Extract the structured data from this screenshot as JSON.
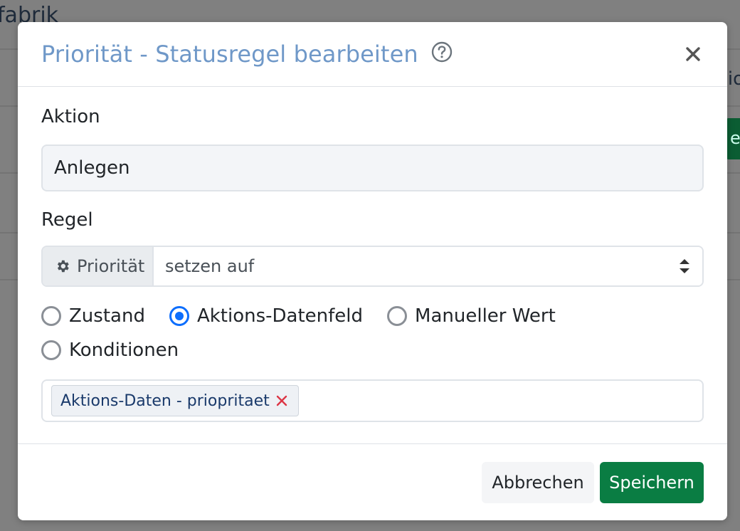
{
  "background": {
    "title_fragment": "fabrik",
    "right_text_fragment": "io",
    "right_button_fragment": "er"
  },
  "modal": {
    "title": "Priorität - Statusregel bearbeiten",
    "action_section": {
      "label": "Aktion",
      "value": "Anlegen"
    },
    "rule_section": {
      "label": "Regel",
      "addon_label": "Priorität",
      "select_value": "setzen auf"
    },
    "radio_options": [
      {
        "label": "Zustand",
        "checked": false
      },
      {
        "label": "Aktions-Datenfeld",
        "checked": true
      },
      {
        "label": "Manueller Wert",
        "checked": false
      },
      {
        "label": "Konditionen",
        "checked": false
      }
    ],
    "tag": {
      "label": "Aktions-Daten - priopritaet"
    },
    "footer": {
      "cancel_label": "Abbrechen",
      "save_label": "Speichern"
    }
  },
  "colors": {
    "title": "#6f98c8",
    "primary": "#0d6efd",
    "save_button": "#0a7d43",
    "tag_remove": "#dc3545"
  },
  "icons": {
    "help": "question-circle-icon",
    "close": "close-icon",
    "gear": "gear-icon",
    "select_arrows": "sort-arrows-icon",
    "tag_remove": "x-icon"
  }
}
